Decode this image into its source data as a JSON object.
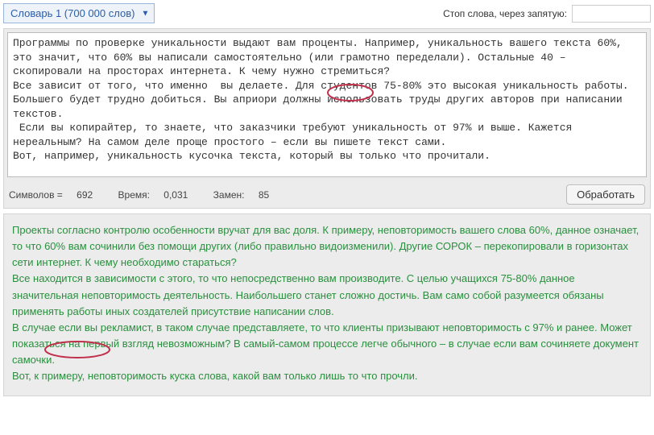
{
  "dictionary": {
    "label": "Словарь 1 (700 000 слов)"
  },
  "stopwords": {
    "label": "Стоп слова, через запятую:",
    "value": ""
  },
  "editor": {
    "text": "Программы по проверке уникальности выдают вам проценты. Например, уникальность вашего текста 60%, это значит, что 60% вы написали самостоятельно (или грамотно переделали). Остальные 40 – скопировали на просторах интернета. К чему нужно стремиться?\nВсе зависит от того, что именно  вы делаете. Для студентов 75-80% это высокая уникальность работы. Большего будет трудно добиться. Вы априори должны использовать труды других авторов при написании текстов.\n Если вы копирайтер, то знаете, что заказчики требуют уникальность от 97% и выше. Кажется нереальным? На самом деле проще простого – если вы пишете текст сами.\nВот, например, уникальность кусочка текста, который вы только что прочитали."
  },
  "stats": {
    "symbols_label": "Символов =",
    "symbols_value": "692",
    "time_label": "Время:",
    "time_value": "0,031",
    "replacements_label": "Замен:",
    "replacements_value": "85"
  },
  "process_button": "Обработать",
  "result": {
    "text": "Проекты согласно контролю особенности вручат для вас доля. К примеру, неповторимость вашего слова 60%, данное означает, то что 60% вам сочинили без помощи других (либо правильно видоизменили). Другие СОРОК – перекопировали в горизонтах сети интернет. К чему необходимо стараться?\nВсе находится в зависимости с этого, то что непосредственно вам производите. С целью учащихся 75-80% данное значительная неповторимость деятельность. Наибольшего станет сложно достичь. Вам само собой разумеется обязаны применять работы иных создателей присутствие написании слов.\nВ случае если вы рекламист, в таком случае представляете, то что клиенты призывают неповторимость с 97% и ранее. Может показаться на первый взгляд невозможным? В самый-самом процессе легче обычного – в случае если вам сочиняете документ самочки.\nВот, к примеру, неповторимость куска слова, какой вам только лишь то что прочли."
  }
}
